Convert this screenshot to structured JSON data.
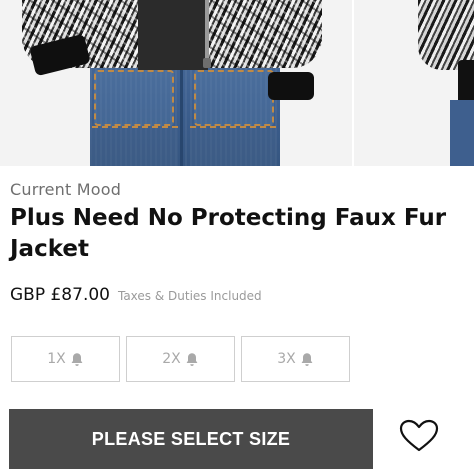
{
  "product": {
    "brand": "Current Mood",
    "title": "Plus Need No Protecting Faux Fur Jacket",
    "price": "GBP £87.00",
    "tax_note": "Taxes & Duties Included"
  },
  "sizes": [
    {
      "label": "1X",
      "icon": "bell-icon",
      "status": "unavailable"
    },
    {
      "label": "2X",
      "icon": "bell-icon",
      "status": "unavailable"
    },
    {
      "label": "3X",
      "icon": "bell-icon",
      "status": "unavailable"
    }
  ],
  "actions": {
    "select_size_label": "PLEASE SELECT SIZE",
    "wishlist_icon": "heart-icon"
  },
  "colors": {
    "cta_background": "#4a4a4a",
    "size_border": "#cfcfcf",
    "muted_text": "#a9a9a9"
  }
}
